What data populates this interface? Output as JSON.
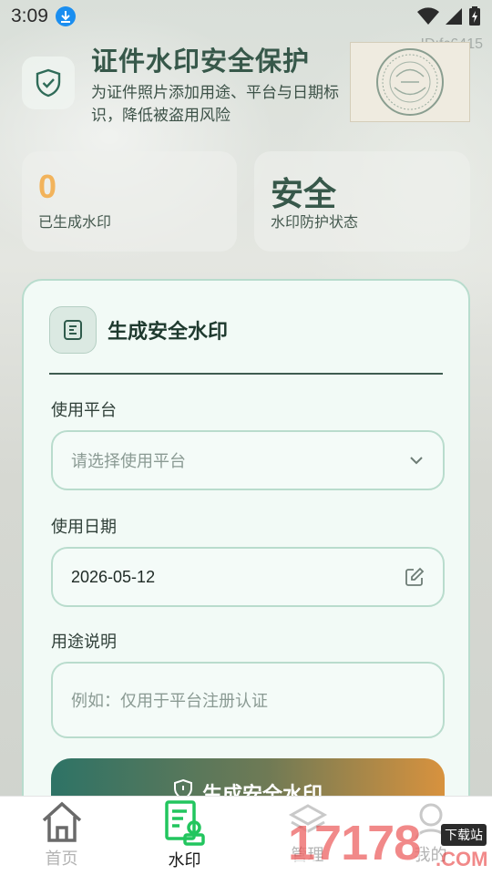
{
  "status_bar": {
    "time": "3:09",
    "icons": [
      "download-icon",
      "wifi-icon",
      "signal-icon",
      "battery-icon"
    ]
  },
  "watermark_id": "ID:fc6415",
  "header": {
    "title": "证件水印安全保护",
    "subtitle": "为证件照片添加用途、平台与日期标识，降低被盗用风险",
    "icon": "shield-check-icon"
  },
  "stats": {
    "count_value": "0",
    "count_label": "已生成水印",
    "status_value": "安全",
    "status_label": "水印防护状态"
  },
  "form": {
    "title": "生成安全水印",
    "platform": {
      "label": "使用平台",
      "placeholder": "请选择使用平台"
    },
    "date": {
      "label": "使用日期",
      "value": "2026-05-12"
    },
    "purpose": {
      "label": "用途说明",
      "placeholder": "例如：仅用于平台注册认证"
    },
    "submit_label": "生成安全水印"
  },
  "nav": {
    "items": [
      {
        "label": "首页",
        "icon": "home-icon",
        "active": false
      },
      {
        "label": "水印",
        "icon": "watermark-icon",
        "active": true
      },
      {
        "label": "管理",
        "icon": "layers-icon",
        "active": false
      },
      {
        "label": "我的",
        "icon": "user-icon",
        "active": false
      }
    ]
  },
  "site_watermark": {
    "text": "17178",
    "badge": "下载站",
    "suffix": ".COM"
  },
  "colors": {
    "primary": "#37584a",
    "accent_orange": "#f2b35b",
    "active_nav": "#22c55e",
    "card_border": "#b9dccd"
  }
}
